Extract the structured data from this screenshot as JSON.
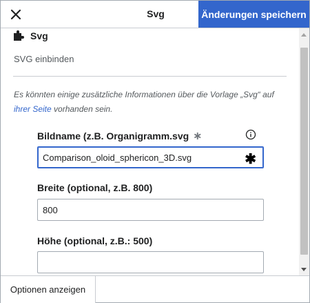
{
  "header": {
    "close_icon": "close-icon",
    "title": "Svg",
    "save_label": "Änderungen speichern"
  },
  "template": {
    "icon": "puzzle-piece-icon",
    "name": "Svg",
    "description": "SVG einbinden"
  },
  "info": {
    "text_before": "Es könnten einige zusätzliche Informationen über die Vorlage „Svg“ auf ",
    "link": "ihrer Seite",
    "text_after": " vorhanden sein."
  },
  "fields": {
    "bildname": {
      "label": "Bildname (z.B. Organigramm.svg",
      "required_mark": "∗",
      "value": "Comparison_oloid_sphericon_3D.svg",
      "input_marker": "✱"
    },
    "breite": {
      "label": "Breite (optional, z.B. 800)",
      "value": "800"
    },
    "hoehe": {
      "label": "Höhe (optional, z.B.: 500)",
      "value": ""
    }
  },
  "footer": {
    "options_label": "Optionen anzeigen"
  },
  "colors": {
    "accent": "#3366cc",
    "border": "#a2a9b1"
  }
}
